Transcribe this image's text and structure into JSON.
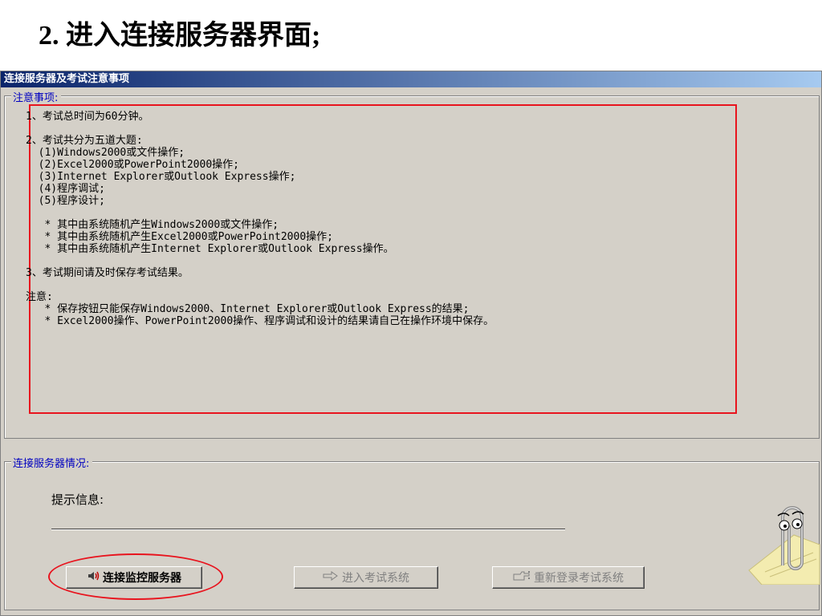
{
  "slide_title": "2. 进入连接服务器界面;",
  "window_title": "连接服务器及考试注意事项",
  "notes_group_label": "注意事项:",
  "notes_lines": [
    "1、考试总时间为60分钟。",
    "",
    "2、考试共分为五道大题:",
    "  (1)Windows2000或文件操作;",
    "  (2)Excel2000或PowerPoint2000操作;",
    "  (3)Internet Explorer或Outlook Express操作;",
    "  (4)程序调试;",
    "  (5)程序设计;",
    "",
    "   * 其中由系统随机产生Windows2000或文件操作;",
    "   * 其中由系统随机产生Excel2000或PowerPoint2000操作;",
    "   * 其中由系统随机产生Internet Explorer或Outlook Express操作。",
    "",
    "3、考试期间请及时保存考试结果。",
    "",
    "注意:",
    "   * 保存按钮只能保存Windows2000、Internet Explorer或Outlook Express的结果;",
    "   * Excel2000操作、PowerPoint2000操作、程序调试和设计的结果请自己在操作环境中保存。"
  ],
  "connection_group_label": "连接服务器情况:",
  "prompt_label": "提示信息:",
  "buttons": {
    "connect": "连接监控服务器",
    "enter": "进入考试系统",
    "relogin": "重新登录考试系统"
  }
}
